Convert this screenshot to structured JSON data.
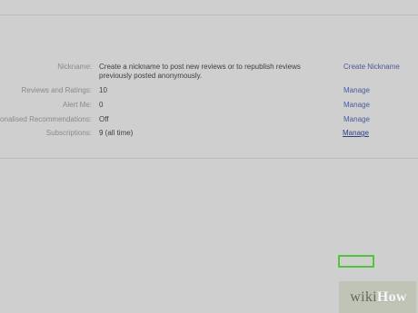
{
  "rows": [
    {
      "label": "Nickname:",
      "value": "Create a nickname to post new reviews or to republish reviews previously posted anonymously.",
      "action": "Create Nickname"
    },
    {
      "label": "Reviews and Ratings:",
      "value": "10",
      "action": "Manage"
    },
    {
      "label": "Alert Me:",
      "value": "0",
      "action": "Manage"
    },
    {
      "label": "onalised Recommendations:",
      "value": "Off",
      "action": "Manage"
    },
    {
      "label": "Subscriptions:",
      "value": "9 (all time)",
      "action": "Manage"
    }
  ],
  "watermark": {
    "wiki": "wiki",
    "how": "How"
  },
  "colors": {
    "background": "#cfcfcf",
    "link": "#4a5a9e",
    "highlight": "#4fc637"
  }
}
